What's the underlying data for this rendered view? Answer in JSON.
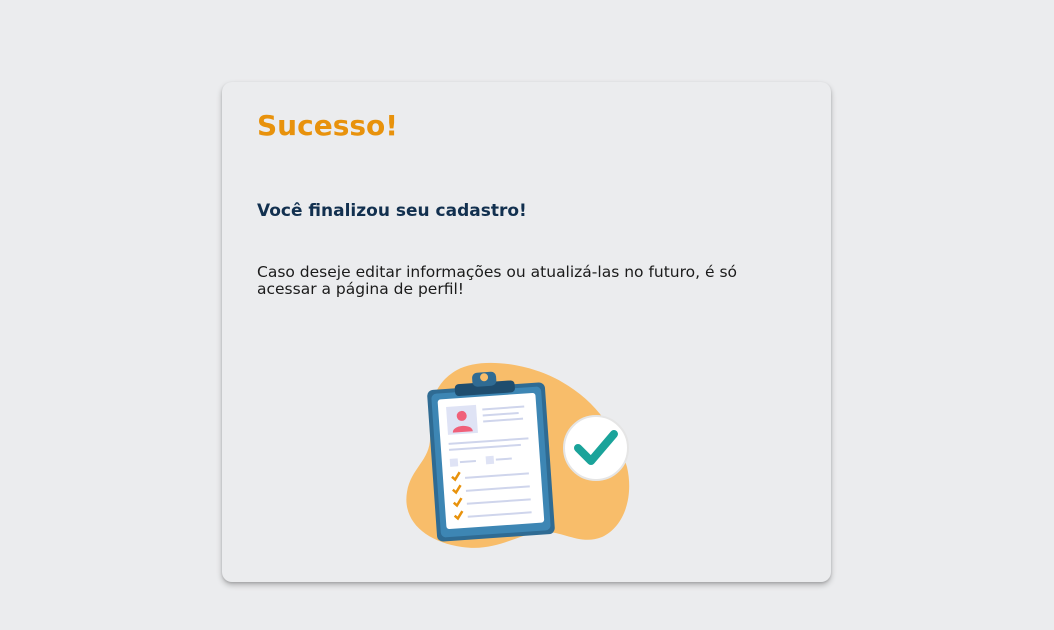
{
  "dialog": {
    "title": "Sucesso!",
    "subtitle": "Você finalizou seu cadastro!",
    "message": "Caso deseje editar informações ou atualizá-las no futuro, é só acessar a página de perfil!"
  },
  "colors": {
    "background": "#ebecee",
    "title": "#e8920c",
    "subtitle": "#12304f",
    "blob": "#f8bd6a",
    "clipboard": "#2f6b93",
    "check": "#1aa39a"
  },
  "illustration": {
    "icon": "clipboard-success-illustration"
  }
}
